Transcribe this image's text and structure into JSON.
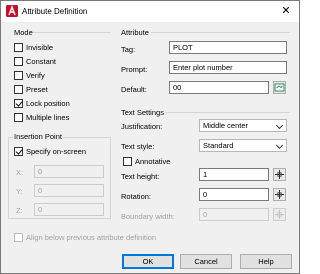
{
  "window": {
    "title": "Attribute Definition",
    "close_glyph": "✕"
  },
  "mode": {
    "label": "Mode",
    "options": [
      {
        "label": "Invisible",
        "checked": false
      },
      {
        "label": "Constant",
        "checked": false
      },
      {
        "label": "Verify",
        "checked": false
      },
      {
        "label": "Preset",
        "checked": false
      },
      {
        "label": "Lock position",
        "checked": true
      },
      {
        "label": "Multiple lines",
        "checked": false
      }
    ]
  },
  "insertion_point": {
    "label": "Insertion Point",
    "specify_on_screen": {
      "label": "Specify on-screen",
      "checked": true
    },
    "x": {
      "label": "X:",
      "value": "0"
    },
    "y": {
      "label": "Y:",
      "value": "0"
    },
    "z": {
      "label": "Z:",
      "value": "0"
    }
  },
  "attribute": {
    "label": "Attribute",
    "tag": {
      "label": "Tag:",
      "value": "PLOT"
    },
    "prompt": {
      "label": "Prompt:",
      "value": "Enter plot number"
    },
    "default": {
      "label": "Default:",
      "value": "00"
    }
  },
  "text_settings": {
    "label": "Text Settings",
    "justification": {
      "label": "Justification:",
      "value": "Middle center"
    },
    "text_style": {
      "label": "Text style:",
      "value": "Standard"
    },
    "annotative": {
      "label": "Annotative",
      "checked": false
    },
    "text_height": {
      "label": "Text height:",
      "value": "1"
    },
    "rotation": {
      "label": "Rotation:",
      "value": "0"
    },
    "boundary_width": {
      "label": "Boundary width:",
      "value": "0"
    }
  },
  "align_below": {
    "label": "Align below previous attribute definition",
    "checked": false
  },
  "buttons": {
    "ok": "OK",
    "cancel": "Cancel",
    "help": "Help"
  },
  "colors": {
    "accent": "#0078d7",
    "autocad_red": "#c8102e",
    "field_icon_green": "#2e8b57"
  }
}
